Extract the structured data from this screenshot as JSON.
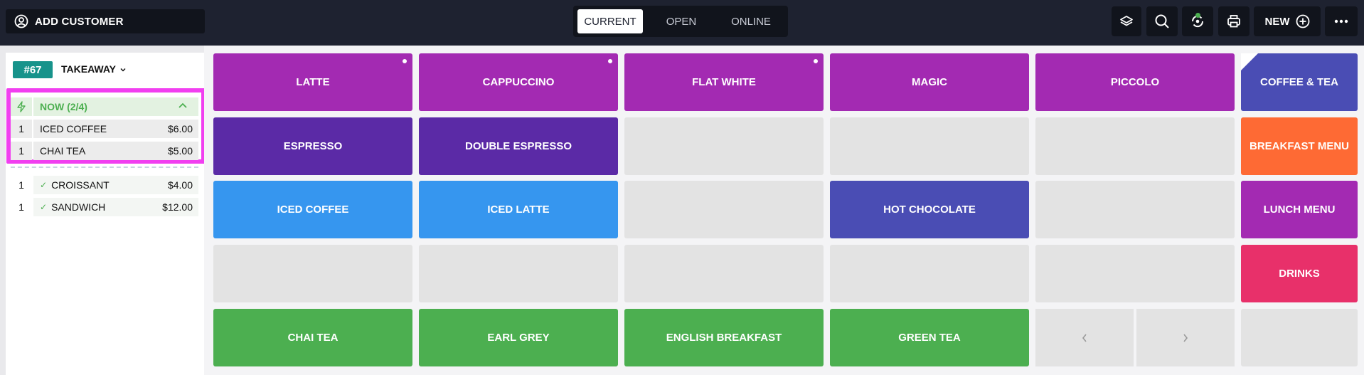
{
  "header": {
    "add_customer": "ADD CUSTOMER",
    "tabs": [
      "CURRENT",
      "OPEN",
      "ONLINE"
    ],
    "new_label": "NEW",
    "icons": [
      "layers-icon",
      "search-icon",
      "sync-icon",
      "printer-icon",
      "plus-circle-icon",
      "more-icon"
    ]
  },
  "order": {
    "number": "#67",
    "type": "TAKEAWAY",
    "now_label": "NOW (2/4)",
    "now_items": [
      {
        "qty": "1",
        "name": "ICED COFFEE",
        "price": "$6.00"
      },
      {
        "qty": "1",
        "name": "CHAI TEA",
        "price": "$5.00"
      }
    ],
    "done_items": [
      {
        "qty": "1",
        "name": "CROISSANT",
        "price": "$4.00"
      },
      {
        "qty": "1",
        "name": "SANDWICH",
        "price": "$12.00"
      }
    ]
  },
  "products": {
    "r1": [
      "LATTE",
      "CAPPUCCINO",
      "FLAT WHITE",
      "MAGIC",
      "PICCOLO"
    ],
    "r2": [
      "ESPRESSO",
      "DOUBLE ESPRESSO"
    ],
    "r3": [
      "ICED COFFEE",
      "ICED LATTE",
      "HOT CHOCOLATE"
    ],
    "r5": [
      "CHAI TEA",
      "EARL GREY",
      "ENGLISH BREAKFAST",
      "GREEN TEA"
    ]
  },
  "categories": [
    "COFFEE & TEA",
    "BREAKFAST MENU",
    "LUNCH MENU",
    "DRINKS"
  ],
  "colors": {
    "purple": "#a32ab2",
    "deep_purple": "#5b2aa6",
    "blue": "#3696ef",
    "indigo": "#4a4db4",
    "green": "#4caf50",
    "orange": "#fe6a34",
    "pink": "#e8306a",
    "teal": "#17938b",
    "highlight": "#f13ff0"
  }
}
